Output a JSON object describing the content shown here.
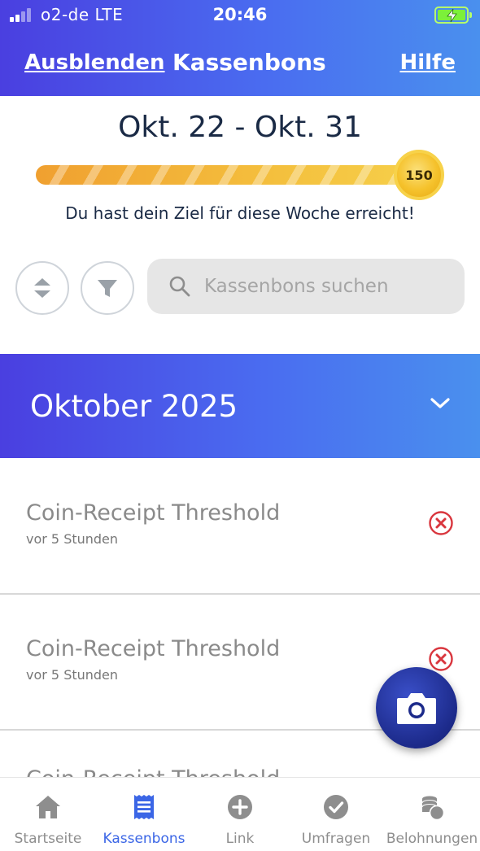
{
  "status_bar": {
    "carrier": "o2-de  LTE",
    "time": "20:46"
  },
  "header": {
    "left_link": "Ausblenden",
    "title": "Kassenbons",
    "right_link": "Hilfe"
  },
  "progress": {
    "date_range": "Okt. 22 - Okt. 31",
    "coins": "150",
    "fill_fraction": 1.0,
    "goal_message": "Du hast dein Ziel für diese Woche erreicht!"
  },
  "search": {
    "placeholder": "Kassenbons suchen",
    "value": ""
  },
  "month_section": {
    "label": "Oktober 2025"
  },
  "receipts": [
    {
      "title": "Coin-Receipt Threshold",
      "time": "vor 5 Stunden"
    },
    {
      "title": "Coin-Receipt Threshold",
      "time": "vor 5 Stunden"
    },
    {
      "title": "Coin-Receipt Threshold"
    }
  ],
  "tabs": [
    {
      "label": "Startseite",
      "icon": "home-icon",
      "active": false
    },
    {
      "label": "Kassenbons",
      "icon": "receipt-icon",
      "active": true
    },
    {
      "label": "Link",
      "icon": "plus-circle-icon",
      "active": false
    },
    {
      "label": "Umfragen",
      "icon": "check-circle-icon",
      "active": false
    },
    {
      "label": "Belohnungen",
      "icon": "coins-icon",
      "active": false
    }
  ],
  "colors": {
    "header_gradient_start": "#4a3fe0",
    "header_gradient_end": "#4a90ee",
    "active_tab": "#3b66e6",
    "inactive_tab": "#8e8e8e",
    "delete_red": "#d9363e",
    "fab": "#1c2a8a",
    "progress_gold": "#f4bf3d"
  }
}
